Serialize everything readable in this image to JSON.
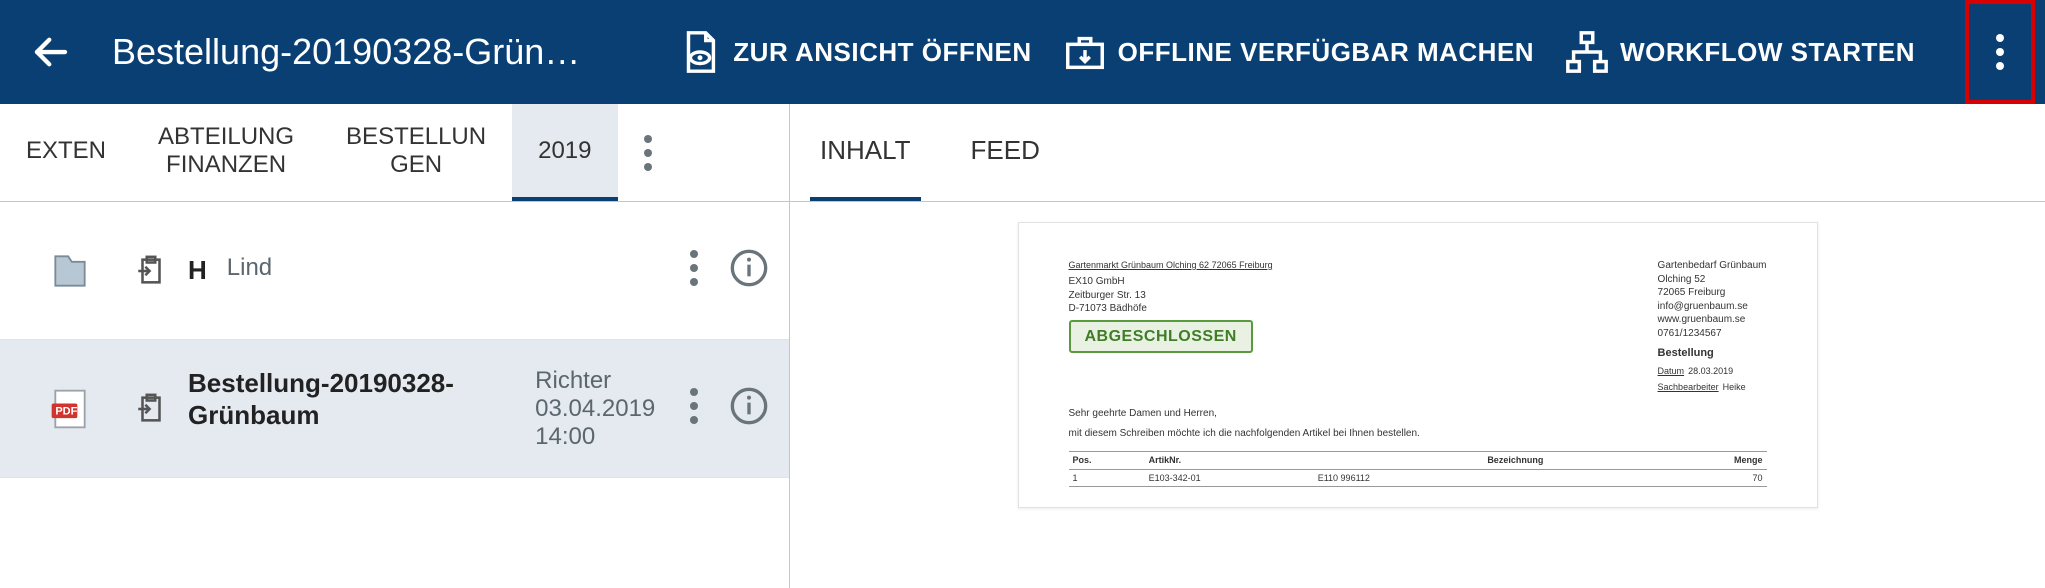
{
  "header": {
    "title": "Bestellung-20190328-Grün…",
    "actions": {
      "open_view": "ZUR ANSICHT ÖFFNEN",
      "offline": "OFFLINE VERFÜGBAR MACHEN",
      "workflow": "WORKFLOW STARTEN"
    }
  },
  "breadcrumbs": [
    "EXTEN",
    "ABTEILUNG\nFINANZEN",
    "BESTELLUN\nGEN",
    "2019"
  ],
  "active_breadcrumb": 3,
  "list": [
    {
      "type": "folder",
      "name": "H",
      "who": "Lind",
      "when": "",
      "selected": false
    },
    {
      "type": "pdf",
      "name": "Bestellung-20190328-Grünbaum",
      "who": "Richter",
      "when": "03.04.2019 14:00",
      "selected": true
    }
  ],
  "right_tabs": [
    "INHALT",
    "FEED"
  ],
  "active_right_tab": 0,
  "preview": {
    "sender_line": "Gartenmarkt Grünbaum Olching 62 72065 Freiburg",
    "recipient": [
      "EX10 GmbH",
      "Zeitburger Str. 13",
      "",
      "D-71073 Bädhöfe"
    ],
    "company_block": [
      "Gartenbedarf Grünbaum",
      "Olching 52",
      "",
      "72065 Freiburg",
      "",
      "info@gruenbaum.se",
      "www.gruenbaum.se",
      "0761/1234567"
    ],
    "stamp": "ABGESCHLOSSEN",
    "order_title": "Bestellung",
    "meta": {
      "date_label": "Datum",
      "date": "28.03.2019",
      "worker_label": "Sachbearbeiter",
      "worker": "Heike"
    },
    "salutation": "Sehr geehrte Damen und Herren,",
    "intro": "mit diesem Schreiben möchte ich die nachfolgenden Artikel bei Ihnen bestellen.",
    "table": {
      "headers": [
        "Pos.",
        "ArtikNr.",
        "",
        "Bezeichnung",
        "Menge"
      ],
      "rows": [
        [
          "1",
          "E103-342-01",
          "E110 996112",
          "",
          "70"
        ]
      ]
    }
  }
}
